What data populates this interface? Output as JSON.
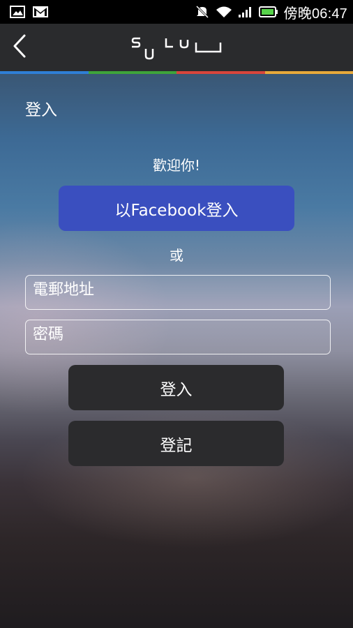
{
  "status_bar": {
    "left_icons": [
      "image-icon",
      "gmail-icon"
    ],
    "right_icons": [
      "mute-icon",
      "wifi-icon",
      "signal-icon",
      "battery-icon"
    ],
    "time": "傍晚06:47"
  },
  "app_bar": {
    "back_icon": "chevron-left-icon",
    "logo_text": "sulu",
    "accent_colors": [
      "#2f7fd6",
      "#3ea43a",
      "#d8453c",
      "#e8a93a"
    ]
  },
  "page": {
    "title": "登入",
    "welcome": "歡迎你!",
    "facebook_label": "以Facebook登入",
    "or_label": "或",
    "email_placeholder": "電郵地址",
    "password_placeholder": "密碼",
    "login_label": "登入",
    "register_label": "登記"
  },
  "colors": {
    "facebook_button": "#3a4fbf",
    "dark_button": "#2b2b2d",
    "app_bar": "#2a2b2d"
  }
}
